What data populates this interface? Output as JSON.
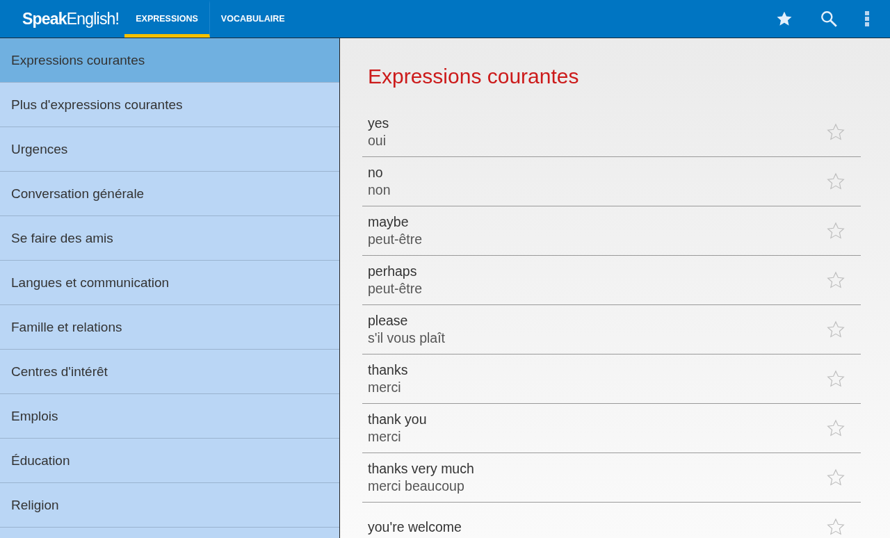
{
  "app_bar": {
    "logo": "**Speak**English!",
    "tabs": [
      {
        "label": "EXPRESSIONS",
        "selected": true
      },
      {
        "label": "VOCABULAIRE",
        "selected": false
      }
    ]
  },
  "sidebar": {
    "items": [
      {
        "label": "Expressions courantes",
        "selected": true
      },
      {
        "label": "Plus d'expressions courantes",
        "selected": false
      },
      {
        "label": "Urgences",
        "selected": false
      },
      {
        "label": "Conversation générale",
        "selected": false
      },
      {
        "label": "Se faire des amis",
        "selected": false
      },
      {
        "label": "Langues et communication",
        "selected": false
      },
      {
        "label": "Famille et relations",
        "selected": false
      },
      {
        "label": "Centres d'intérêt",
        "selected": false
      },
      {
        "label": "Emplois",
        "selected": false
      },
      {
        "label": "Éducation",
        "selected": false
      },
      {
        "label": "Religion",
        "selected": false
      }
    ]
  },
  "content": {
    "title": "Expressions courantes",
    "phrases": [
      {
        "english": "yes",
        "french": "oui",
        "favorite": false
      },
      {
        "english": "no",
        "french": "non",
        "favorite": false
      },
      {
        "english": "maybe",
        "french": "peut-être",
        "favorite": false
      },
      {
        "english": "perhaps",
        "french": "peut-être",
        "favorite": false
      },
      {
        "english": "please",
        "french": "s'il vous plaît",
        "favorite": false
      },
      {
        "english": "thanks",
        "french": "merci",
        "favorite": false
      },
      {
        "english": "thank you",
        "french": "merci",
        "favorite": false
      },
      {
        "english": "thanks very much",
        "french": "merci beaucoup",
        "favorite": false
      },
      {
        "english": "you're welcome",
        "favorite": false
      }
    ]
  }
}
